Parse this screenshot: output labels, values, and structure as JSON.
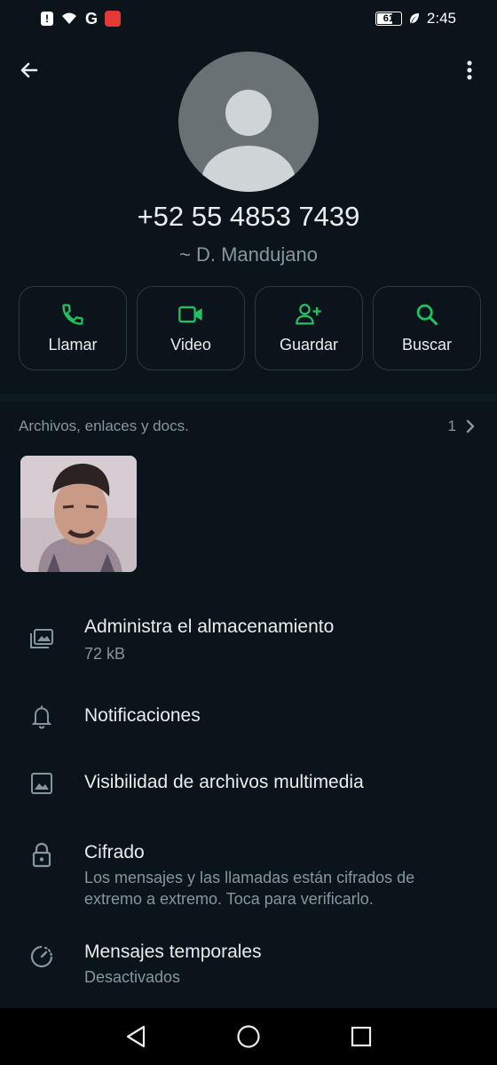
{
  "status_bar": {
    "battery": "61",
    "time": "2:45",
    "carrier_glyph": "G"
  },
  "contact": {
    "phone": "+52 55 4853 7439",
    "nickname": "~ D. Mandujano"
  },
  "actions": [
    {
      "label": "Llamar",
      "icon": "phone-icon"
    },
    {
      "label": "Video",
      "icon": "video-icon"
    },
    {
      "label": "Guardar",
      "icon": "add-contact-icon"
    },
    {
      "label": "Buscar",
      "icon": "search-icon"
    }
  ],
  "media": {
    "title": "Archivos, enlaces y docs.",
    "count": "1"
  },
  "settings": [
    {
      "title": "Administra el almacenamiento",
      "subtitle": "72 kB",
      "icon": "storage-icon"
    },
    {
      "title": "Notificaciones",
      "subtitle": "",
      "icon": "bell-icon"
    },
    {
      "title": "Visibilidad de archivos multimedia",
      "subtitle": "",
      "icon": "image-icon"
    },
    {
      "title": "Cifrado",
      "subtitle": "Los mensajes y las llamadas están cifrados de extremo a extremo. Toca para verificarlo.",
      "icon": "lock-icon"
    },
    {
      "title": "Mensajes temporales",
      "subtitle": "Desactivados",
      "icon": "timer-icon"
    }
  ],
  "colors": {
    "background": "#0b141a",
    "accent": "#21c063",
    "text_primary": "#e9edef",
    "text_secondary": "#8696a0"
  }
}
